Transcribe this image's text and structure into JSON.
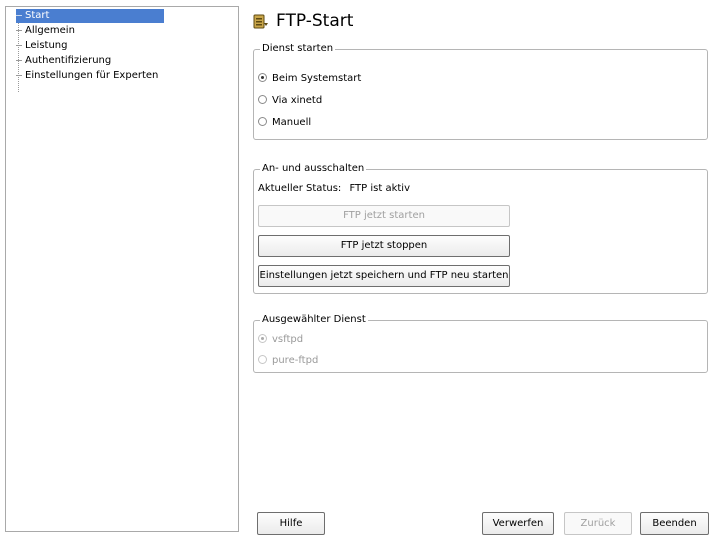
{
  "sidebar": {
    "items": [
      {
        "label": "Start",
        "selected": true
      },
      {
        "label": "Allgemein"
      },
      {
        "label": "Leistung"
      },
      {
        "label": "Authentifizierung"
      },
      {
        "label": "Einstellungen für Experten"
      }
    ]
  },
  "page": {
    "title": "FTP-Start",
    "title_icon": "ftp-folder-icon"
  },
  "dienst_starten": {
    "title": "Dienst starten",
    "options": [
      {
        "label": "Beim Systemstart",
        "checked": true
      },
      {
        "label": "Via xinetd",
        "checked": false
      },
      {
        "label": "Manuell",
        "checked": false
      }
    ]
  },
  "an_aus": {
    "title": "An- und ausschalten",
    "status_label": "Aktueller Status:",
    "status_value": "FTP ist aktiv",
    "start_button": "FTP jetzt starten",
    "stop_button": "FTP jetzt stoppen",
    "save_restart_button": "Einstellungen jetzt speichern und FTP neu starten"
  },
  "ausgewaehlter_dienst": {
    "title": "Ausgewählter Dienst",
    "options": [
      {
        "label": "vsftpd",
        "checked": true,
        "disabled": true
      },
      {
        "label": "pure-ftpd",
        "checked": false,
        "disabled": true
      }
    ]
  },
  "footer": {
    "help": "Hilfe",
    "discard": "Verwerfen",
    "back": "Zurück",
    "finish": "Beenden"
  },
  "colors": {
    "selection": "#4a7ed0",
    "border": "#b5b5b5"
  }
}
